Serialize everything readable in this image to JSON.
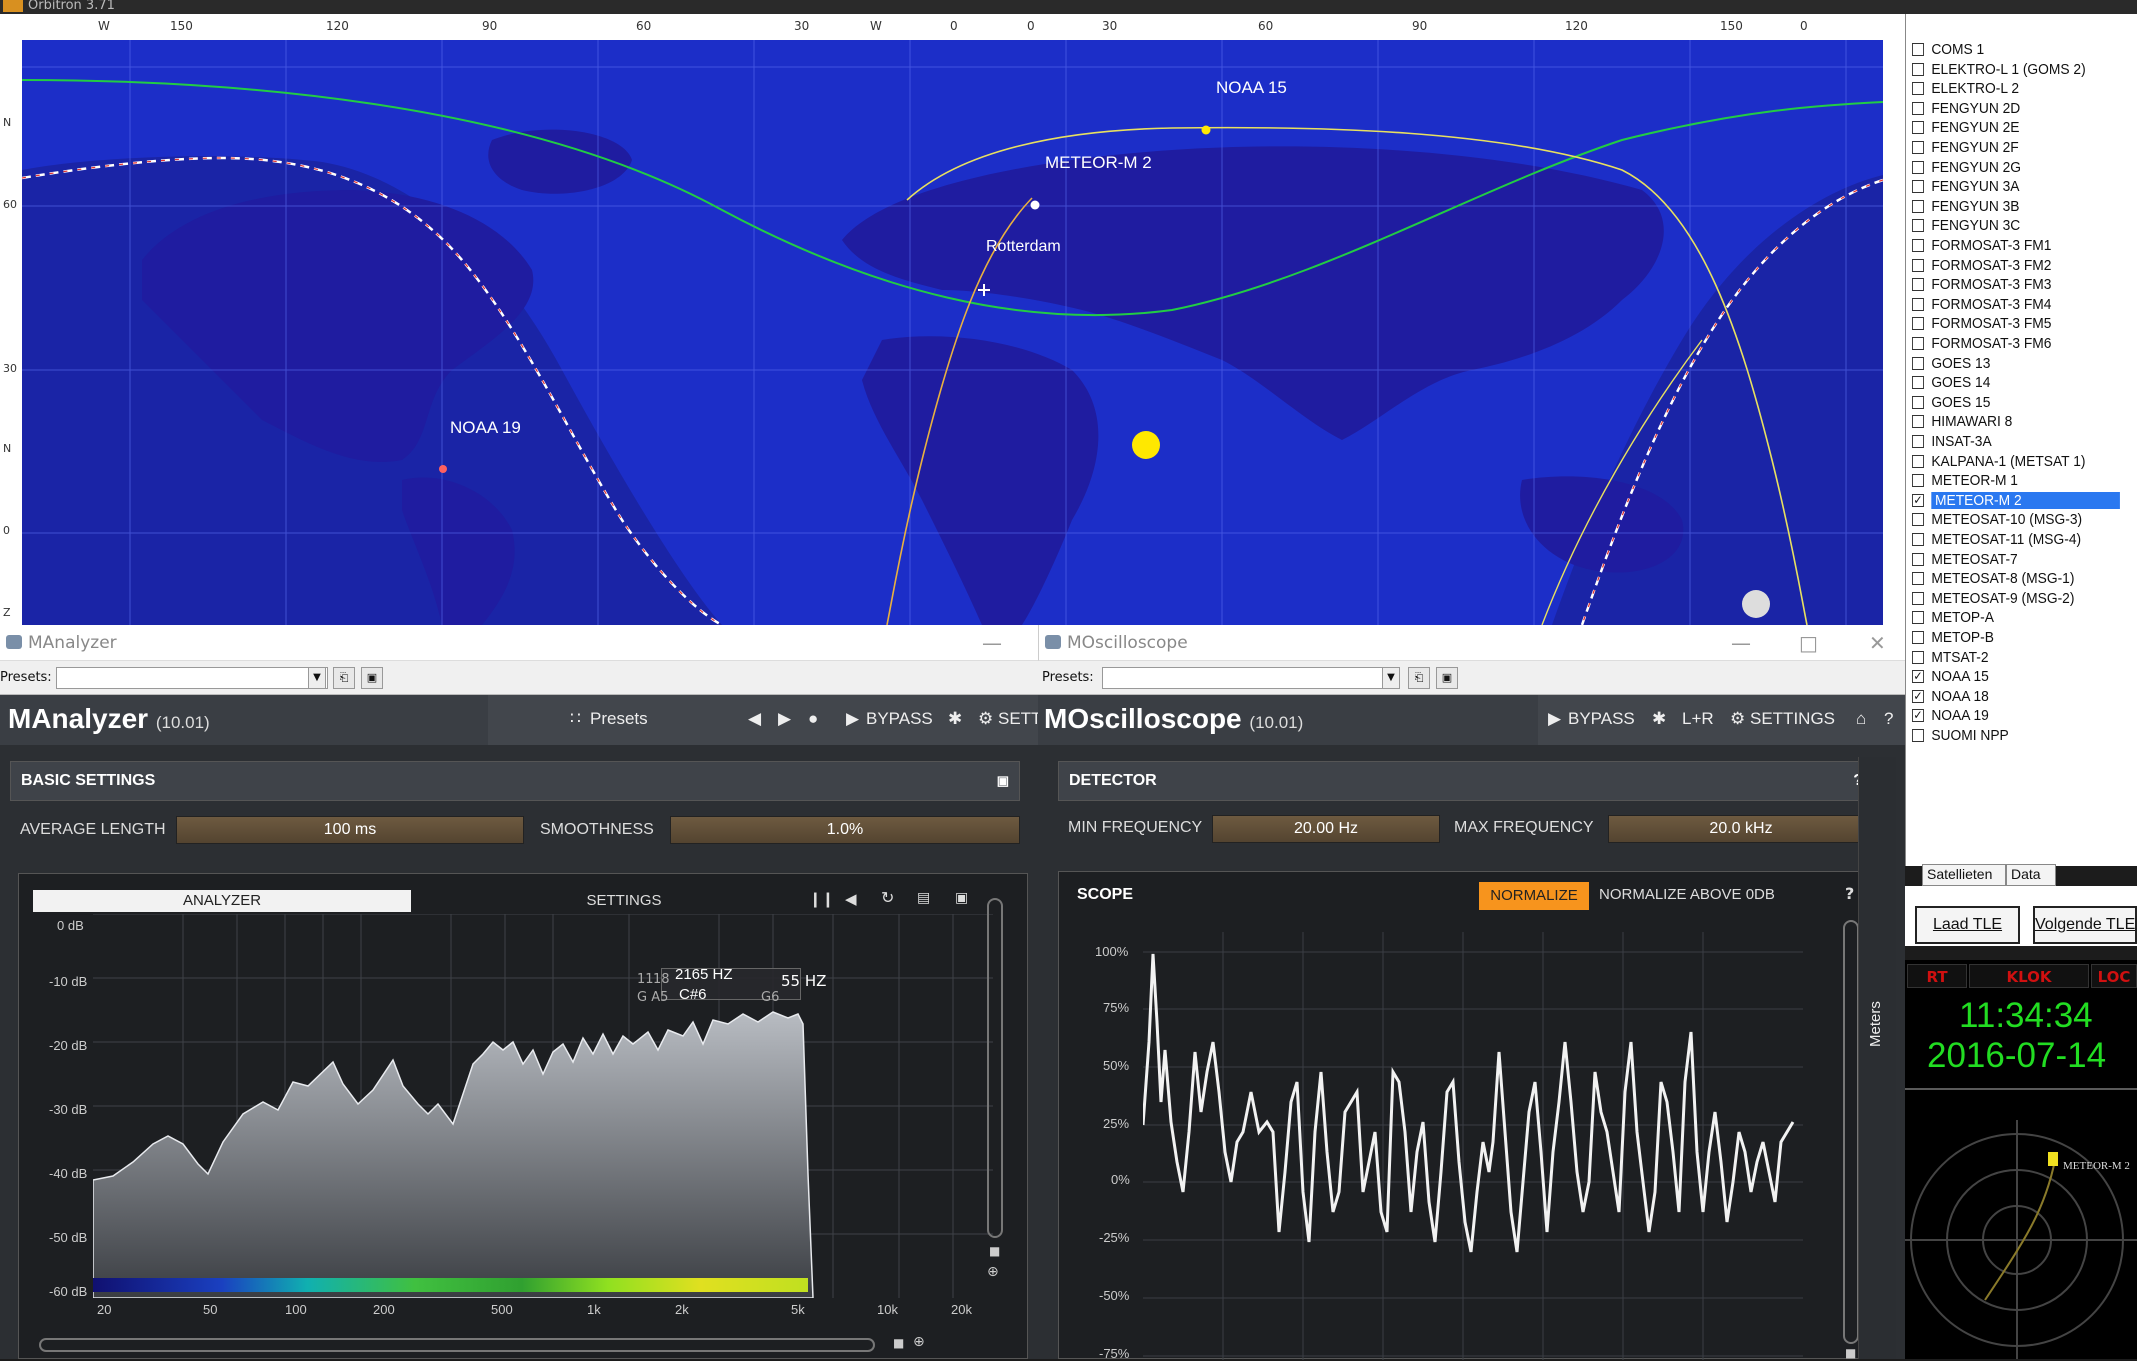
{
  "orbitron": {
    "title": "Orbitron 3.71",
    "ruler_labels": [
      "W",
      "150",
      "120",
      "90",
      "60",
      "30",
      "W",
      "0",
      "0",
      "30",
      "60",
      "90",
      "120",
      "150",
      "0"
    ],
    "lat_labels": [
      "N",
      "60",
      "30",
      "N",
      "0",
      "Z"
    ],
    "map_labels": {
      "noaa15": "NOAA 15",
      "meteor": "METEOR-M 2",
      "rotterdam": "Rotterdam",
      "noaa19": "NOAA 19"
    },
    "satellites": [
      {
        "name": "COMS 1",
        "checked": false
      },
      {
        "name": "ELEKTRO-L 1 (GOMS 2)",
        "checked": false
      },
      {
        "name": "ELEKTRO-L 2",
        "checked": false
      },
      {
        "name": "FENGYUN 2D",
        "checked": false
      },
      {
        "name": "FENGYUN 2E",
        "checked": false
      },
      {
        "name": "FENGYUN 2F",
        "checked": false
      },
      {
        "name": "FENGYUN 2G",
        "checked": false
      },
      {
        "name": "FENGYUN 3A",
        "checked": false
      },
      {
        "name": "FENGYUN 3B",
        "checked": false
      },
      {
        "name": "FENGYUN 3C",
        "checked": false
      },
      {
        "name": "FORMOSAT-3 FM1",
        "checked": false
      },
      {
        "name": "FORMOSAT-3 FM2",
        "checked": false
      },
      {
        "name": "FORMOSAT-3 FM3",
        "checked": false
      },
      {
        "name": "FORMOSAT-3 FM4",
        "checked": false
      },
      {
        "name": "FORMOSAT-3 FM5",
        "checked": false
      },
      {
        "name": "FORMOSAT-3 FM6",
        "checked": false
      },
      {
        "name": "GOES 13",
        "checked": false
      },
      {
        "name": "GOES 14",
        "checked": false
      },
      {
        "name": "GOES 15",
        "checked": false
      },
      {
        "name": "HIMAWARI 8",
        "checked": false
      },
      {
        "name": "INSAT-3A",
        "checked": false
      },
      {
        "name": "KALPANA-1 (METSAT 1)",
        "checked": false
      },
      {
        "name": "METEOR-M 1",
        "checked": false
      },
      {
        "name": "METEOR-M 2",
        "checked": true,
        "selected": true
      },
      {
        "name": "METEOSAT-10 (MSG-3)",
        "checked": false
      },
      {
        "name": "METEOSAT-11 (MSG-4)",
        "checked": false
      },
      {
        "name": "METEOSAT-7",
        "checked": false
      },
      {
        "name": "METEOSAT-8 (MSG-1)",
        "checked": false
      },
      {
        "name": "METEOSAT-9 (MSG-2)",
        "checked": false
      },
      {
        "name": "METOP-A",
        "checked": false
      },
      {
        "name": "METOP-B",
        "checked": false
      },
      {
        "name": "MTSAT-2",
        "checked": false
      },
      {
        "name": "NOAA 15",
        "checked": true
      },
      {
        "name": "NOAA 18",
        "checked": true
      },
      {
        "name": "NOAA 19",
        "checked": true
      },
      {
        "name": "SUOMI NPP",
        "checked": false
      }
    ],
    "tabs": [
      "Satellieten",
      "Data"
    ],
    "load_tle": "Laad TLE",
    "next_tle": "Volgende TLE",
    "clock_headers": [
      "RT",
      "KLOK",
      "LOC"
    ],
    "time": "11:34:34",
    "date": "2016-07-14",
    "radar_label": "METEOR-M 2"
  },
  "analyzer": {
    "window_title": "MAnalyzer",
    "presets_label": "Presets:",
    "name": "MAnalyzer",
    "version": "(10.01)",
    "presets_button": "Presets",
    "bypass": "BYPASS",
    "settings": "SETT",
    "section": "BASIC SETTINGS",
    "avg_label": "AVERAGE LENGTH",
    "avg_value": "100 ms",
    "smooth_label": "SMOOTHNESS",
    "smooth_value": "1.0%",
    "tab_analyzer": "ANALYZER",
    "tab_settings": "SETTINGS",
    "db_labels": [
      "0 dB",
      "-10 dB",
      "-20 dB",
      "-30 dB",
      "-40 dB",
      "-50 dB",
      "-60 dB"
    ],
    "freq_labels": [
      "20",
      "50",
      "100",
      "200",
      "500",
      "1k",
      "2k",
      "5k",
      "10k",
      "20k"
    ],
    "tip_main": "2165 HZ",
    "tip_note": "C#6",
    "tip_a1": "11",
    "tip_a2": "18",
    "tip_a3": "G A5",
    "tip_b1": "55 HZ",
    "tip_b2": "G6"
  },
  "oscilloscope": {
    "window_title": "MOscilloscope",
    "presets_label": "Presets:",
    "name": "MOscilloscope",
    "version": "(10.01)",
    "bypass": "BYPASS",
    "lr": "L+R",
    "settings": "SETTINGS",
    "section": "DETECTOR",
    "min_label": "MIN FREQUENCY",
    "min_value": "20.00 Hz",
    "max_label": "MAX FREQUENCY",
    "max_value": "20.0 kHz",
    "scope_title": "SCOPE",
    "normalize": "NORMALIZE",
    "normalize_above": "NORMALIZE ABOVE 0DB",
    "y_labels": [
      "100%",
      "75%",
      "50%",
      "25%",
      "0%",
      "-25%",
      "-50%",
      "-75%"
    ],
    "meters": "Meters",
    "help": "?"
  },
  "colors": {
    "map_bg": "#1c2ec8",
    "accent": "#f7941d",
    "selected": "#2a78f0",
    "clock_green": "#22dd22"
  }
}
